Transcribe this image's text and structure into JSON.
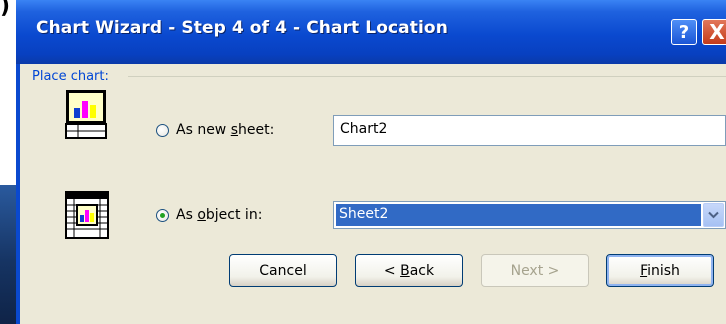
{
  "window": {
    "title": "Chart Wizard - Step 4 of 4 - Chart Location",
    "help_glyph": "?",
    "close_glyph": "X"
  },
  "group": {
    "label": "Place chart:"
  },
  "options": {
    "new_sheet": {
      "label_pre": "As new ",
      "label_key": "s",
      "label_post": "heet:",
      "selected": false,
      "value": "Chart2"
    },
    "object_in": {
      "label_pre": "As ",
      "label_key": "o",
      "label_post": "bject in:",
      "selected": true,
      "value": "Sheet2"
    }
  },
  "buttons": {
    "cancel": "Cancel",
    "back_key": "B",
    "back_prefix": "< ",
    "back_rest": "ack",
    "next": "Next >",
    "finish_key": "F",
    "finish_rest": "inish"
  },
  "colors": {
    "titlebar": "#0a49cf",
    "client": "#ece9d8",
    "selection": "#316ac5",
    "group_label": "#0046d5"
  }
}
